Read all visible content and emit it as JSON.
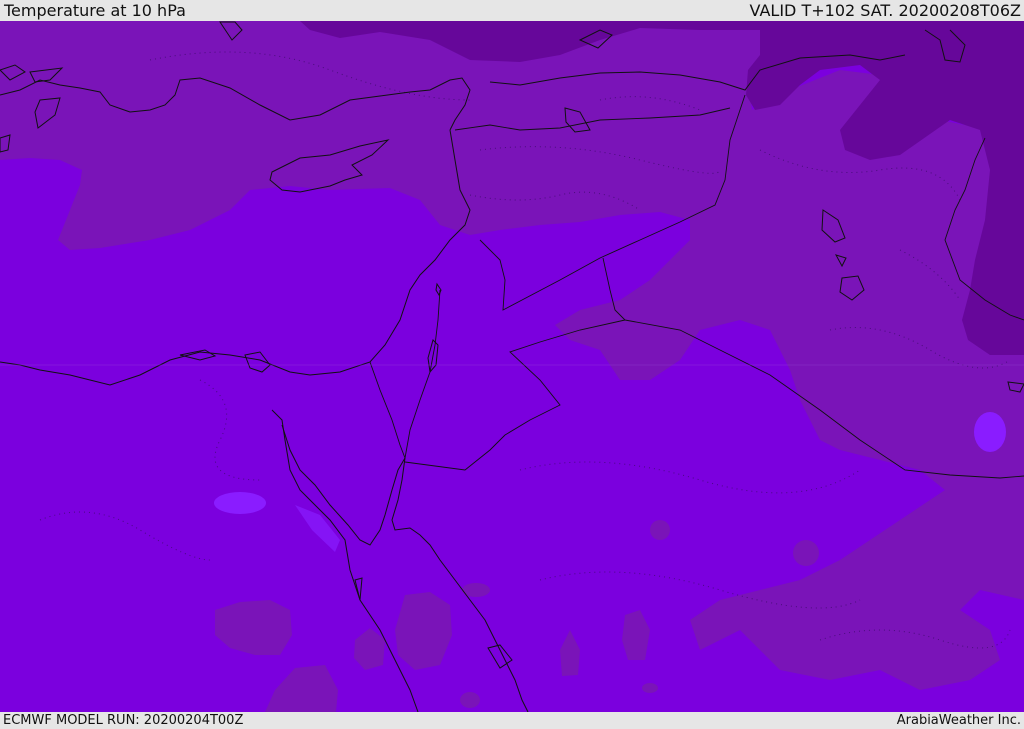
{
  "header": {
    "title": "Temperature at 10 hPa",
    "valid_time": "VALID T+102 SAT. 20200208T06Z"
  },
  "footer": {
    "model_run": "ECMWF MODEL RUN: 20200204T00Z",
    "credit": "ArabiaWeather Inc."
  },
  "map": {
    "variable": "temperature",
    "pressure_level_hpa": 10,
    "palette": {
      "band_warmest": "#7b00de",
      "band_mid": "#7a14b8",
      "band_cold": "#66079a",
      "band_warm_patch": "#8a1cff",
      "coastline": "#111111",
      "border": "#111111"
    }
  }
}
